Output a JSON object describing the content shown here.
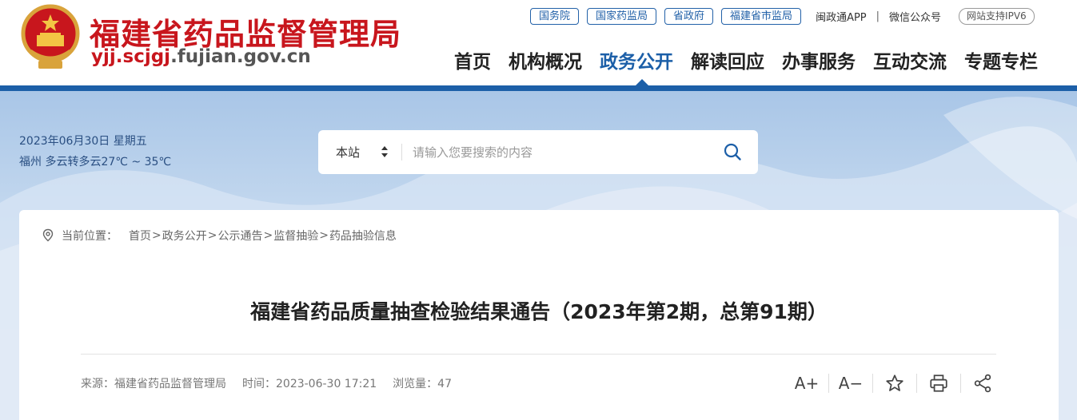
{
  "header": {
    "site_name": "福建省药品监督管理局",
    "domain_red": "yjj.scjgj",
    "domain_gray": ".fujian.gov.cn",
    "top_links": [
      "国务院",
      "国家药监局",
      "省政府",
      "福建省市监局"
    ],
    "app_link": "闽政通APP",
    "separator": "|",
    "wechat_link": "微信公众号",
    "ipv6_badge": "网站支持IPV6",
    "nav": [
      {
        "label": "首页"
      },
      {
        "label": "机构概况"
      },
      {
        "label": "政务公开"
      },
      {
        "label": "解读回应"
      },
      {
        "label": "办事服务"
      },
      {
        "label": "互动交流"
      },
      {
        "label": "专题专栏"
      }
    ],
    "active_nav": "政务公开"
  },
  "banner": {
    "date": "2023年06月30日 星期五",
    "weather": "福州 多云转多云27℃ ~ 35℃"
  },
  "search": {
    "scope": "本站",
    "placeholder": "请输入您要搜索的内容"
  },
  "breadcrumb": {
    "label": "当前位置：",
    "items": [
      "首页",
      "政务公开",
      "公示通告",
      "监督抽验",
      "药品抽验信息"
    ],
    "separator": ">"
  },
  "article": {
    "title": "福建省药品质量抽查检验结果通告（2023年第2期，总第91期）",
    "source": "来源：福建省药品监督管理局",
    "time": "时间：2023-06-30 17:21",
    "views": "浏览量：47"
  },
  "tools": {
    "font_increase": "A+",
    "font_decrease": "A−"
  },
  "colors": {
    "brand_red": "#c8161d",
    "nav_blue": "#1c5fa8"
  },
  "icons": [
    "national-emblem-icon",
    "location-pin-icon",
    "sort-arrows-icon",
    "search-icon",
    "star-icon",
    "print-icon",
    "share-icon"
  ]
}
